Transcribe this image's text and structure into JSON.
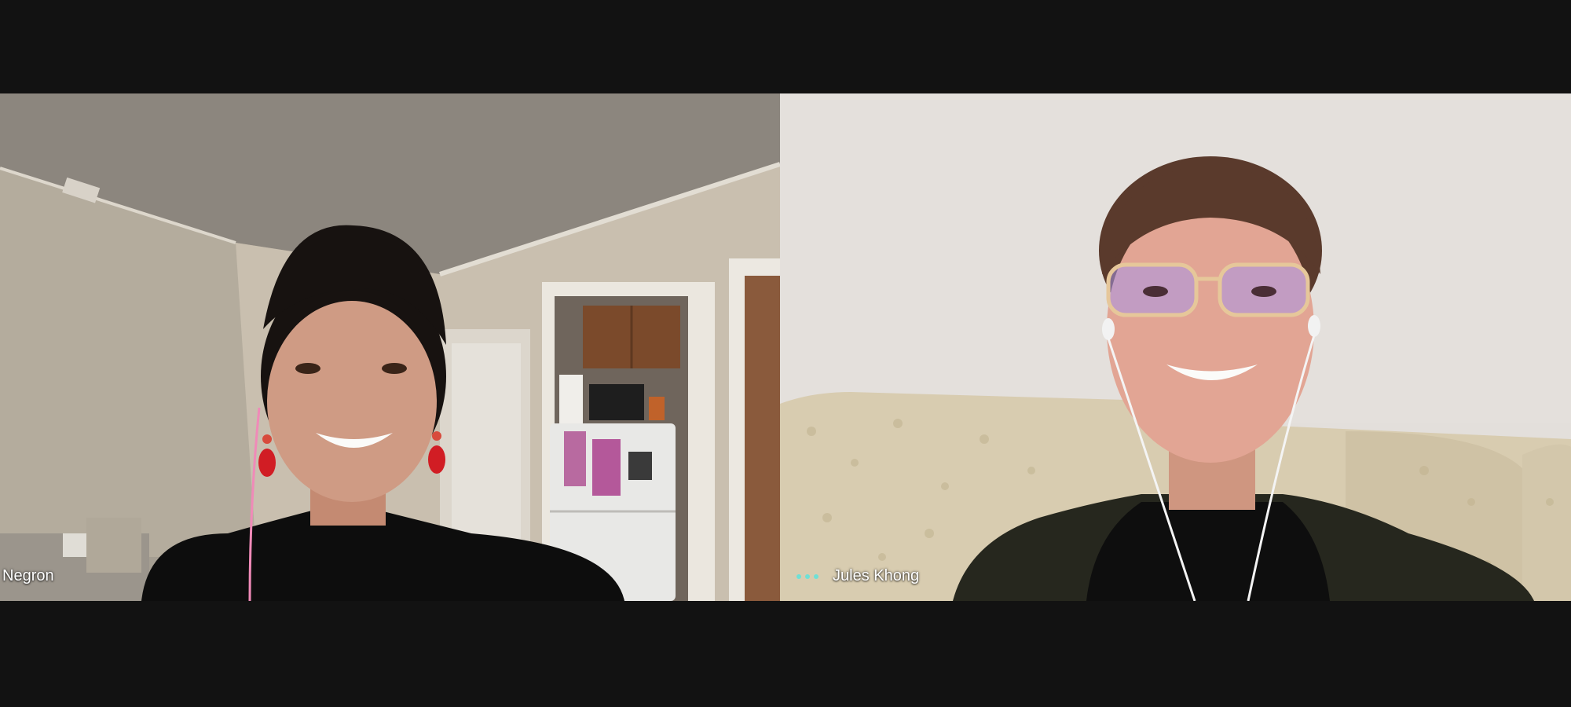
{
  "participants": [
    {
      "name": "Negron",
      "speaking": false
    },
    {
      "name": "Jules Khong",
      "speaking": true
    }
  ],
  "colors": {
    "background": "#121212",
    "label_text": "#ffffff",
    "speaking_indicator": "#6fe0d6"
  },
  "icons": {
    "speaking_indicator": "three-dots-audio-icon"
  }
}
